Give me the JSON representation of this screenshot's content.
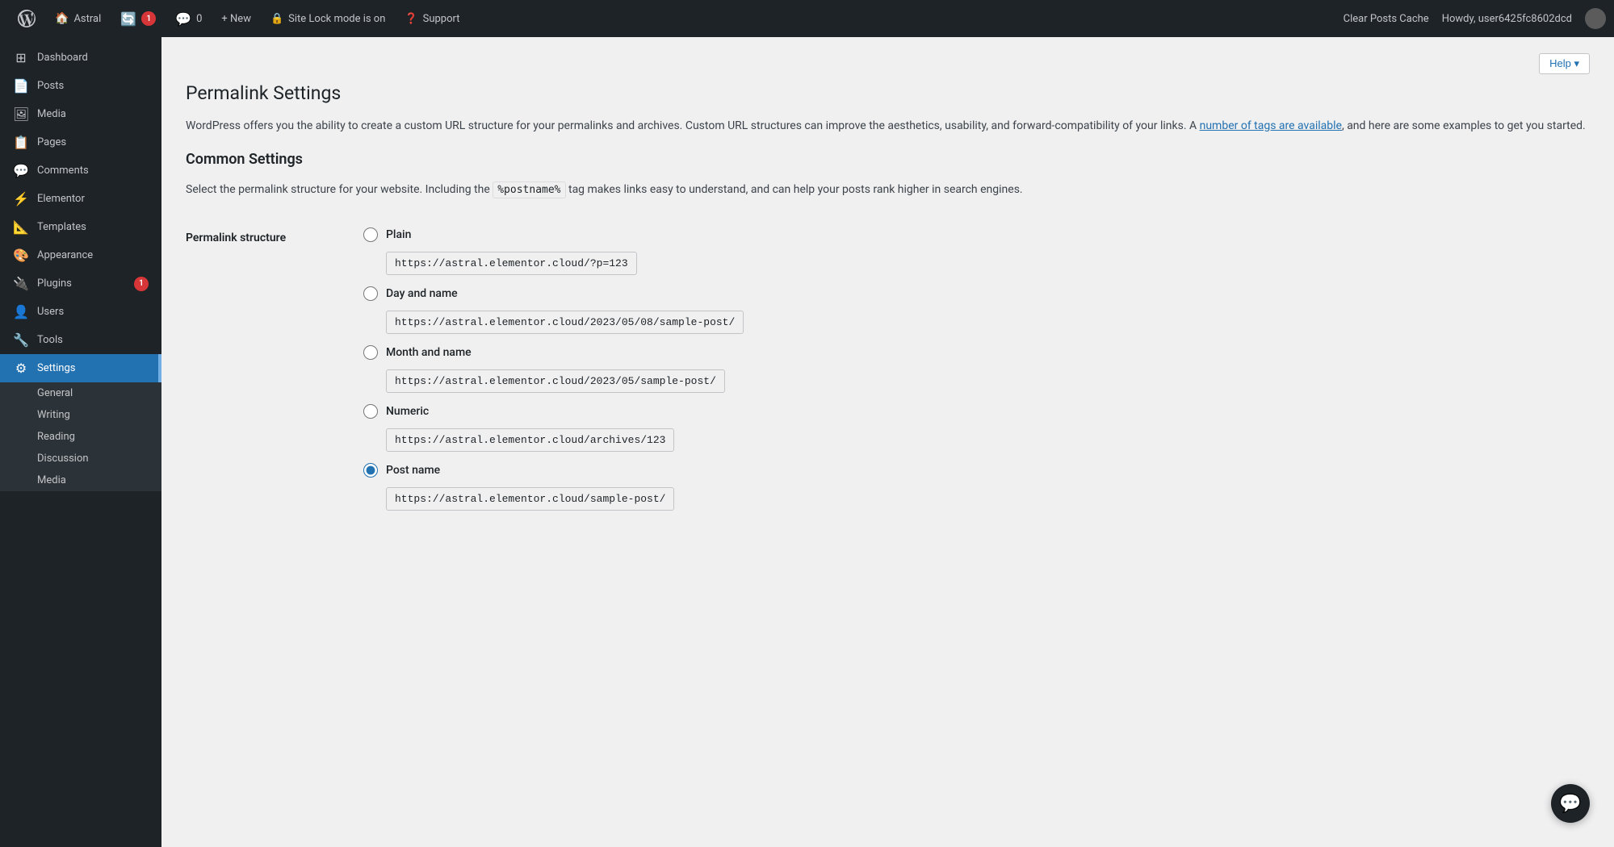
{
  "adminbar": {
    "wplogo_label": "WordPress",
    "site_name": "Astral",
    "updates_count": "1",
    "comments_label": "0",
    "new_label": "+ New",
    "site_lock_label": "Site Lock mode is on",
    "support_label": "Support",
    "clear_cache_label": "Clear Posts Cache",
    "howdy_label": "Howdy, user6425fc8602dcd"
  },
  "sidebar": {
    "items": [
      {
        "id": "dashboard",
        "label": "Dashboard",
        "icon": "⊞"
      },
      {
        "id": "posts",
        "label": "Posts",
        "icon": "📄"
      },
      {
        "id": "media",
        "label": "Media",
        "icon": "🖼"
      },
      {
        "id": "pages",
        "label": "Pages",
        "icon": "📋"
      },
      {
        "id": "comments",
        "label": "Comments",
        "icon": "💬"
      },
      {
        "id": "elementor",
        "label": "Elementor",
        "icon": "⚡"
      },
      {
        "id": "templates",
        "label": "Templates",
        "icon": "📐"
      },
      {
        "id": "appearance",
        "label": "Appearance",
        "icon": "🎨"
      },
      {
        "id": "plugins",
        "label": "Plugins",
        "icon": "🔌",
        "badge": "1"
      },
      {
        "id": "users",
        "label": "Users",
        "icon": "👤"
      },
      {
        "id": "tools",
        "label": "Tools",
        "icon": "🔧"
      },
      {
        "id": "settings",
        "label": "Settings",
        "icon": "⚙",
        "active": true
      }
    ],
    "submenu": [
      {
        "id": "general",
        "label": "General"
      },
      {
        "id": "writing",
        "label": "Writing"
      },
      {
        "id": "reading",
        "label": "Reading"
      },
      {
        "id": "discussion",
        "label": "Discussion"
      },
      {
        "id": "media",
        "label": "Media"
      }
    ]
  },
  "page": {
    "title": "Permalink Settings",
    "help_label": "Help ▾",
    "description": "WordPress offers you the ability to create a custom URL structure for your permalinks and archives. Custom URL structures can improve the aesthetics, usability, and forward-compatibility of your links. A ",
    "tags_link": "number of tags are available",
    "description_end": ", and here are some examples to get you started.",
    "common_settings_title": "Common Settings",
    "select_description_start": "Select the permalink structure for your website. Including the ",
    "postname_code": "%postname%",
    "select_description_end": " tag makes links easy to understand, and can help your posts rank higher in search engines.",
    "permalink_structure_label": "Permalink structure",
    "options": [
      {
        "id": "plain",
        "label": "Plain",
        "url": "https://astral.elementor.cloud/?p=123",
        "checked": false
      },
      {
        "id": "day_and_name",
        "label": "Day and name",
        "url": "https://astral.elementor.cloud/2023/05/08/sample-post/",
        "checked": false
      },
      {
        "id": "month_and_name",
        "label": "Month and name",
        "url": "https://astral.elementor.cloud/2023/05/sample-post/",
        "checked": false
      },
      {
        "id": "numeric",
        "label": "Numeric",
        "url": "https://astral.elementor.cloud/archives/123",
        "checked": false
      },
      {
        "id": "post_name",
        "label": "Post name",
        "url": "https://astral.elementor.cloud/sample-post/",
        "checked": true
      }
    ]
  }
}
